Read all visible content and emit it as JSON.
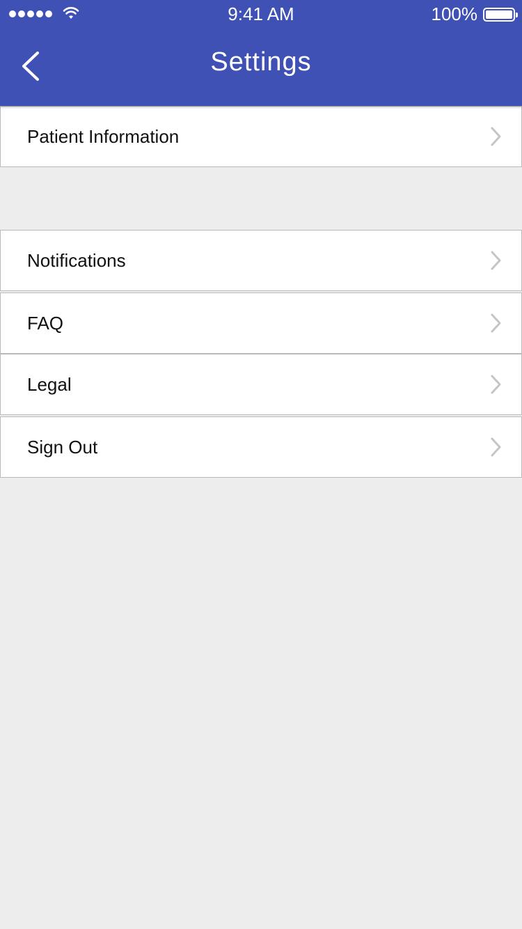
{
  "status_bar": {
    "time": "9:41 AM",
    "battery_percent": "100%",
    "signal_icon": "signal-dots-icon",
    "wifi_icon": "wifi-icon",
    "battery_icon": "battery-full-icon"
  },
  "header": {
    "title": "Settings",
    "back_icon": "chevron-left-icon",
    "background_color": "#3f51b5"
  },
  "settings": {
    "items": [
      {
        "label": "Patient Information"
      },
      {
        "label": "Notifications"
      },
      {
        "label": "FAQ"
      },
      {
        "label": "Legal"
      },
      {
        "label": "Sign Out"
      }
    ],
    "row_chevron_icon": "chevron-right-icon"
  }
}
